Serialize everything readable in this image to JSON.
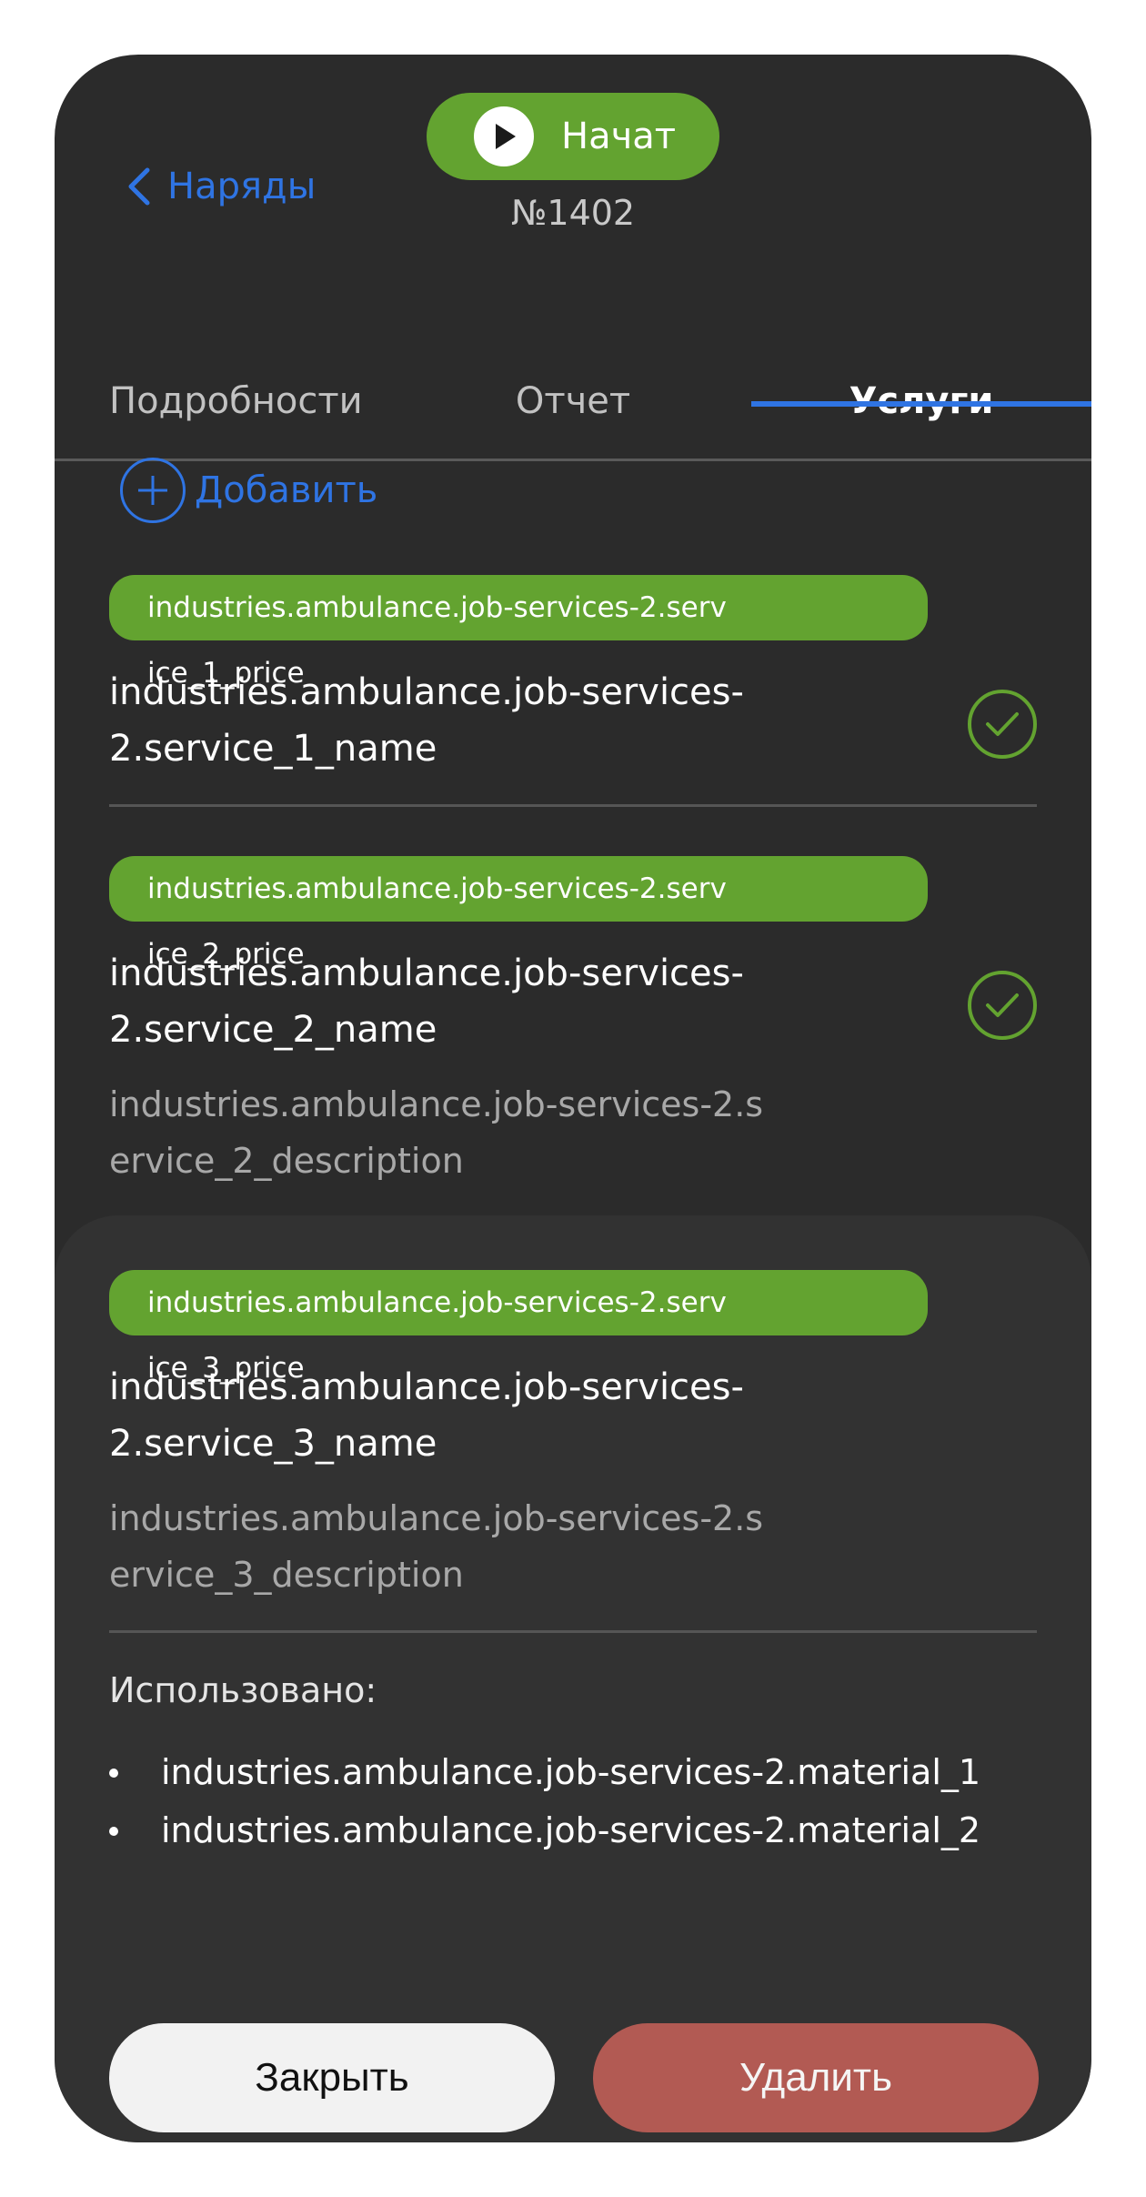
{
  "header": {
    "back_label": "Наряды",
    "start_label": "Начат",
    "order_number": "№1402"
  },
  "tabs": [
    {
      "label": "Подробности",
      "active": false
    },
    {
      "label": "Отчет",
      "active": false
    },
    {
      "label": "Услуги",
      "active": true
    }
  ],
  "add_label": "Добавить",
  "services": [
    {
      "price": "industries.ambulance.job-services-2.service_1_price",
      "name": "industries.ambulance.job-services-2.service_1_name",
      "description": "",
      "checked": true
    },
    {
      "price": "industries.ambulance.job-services-2.service_2_price",
      "name": "industries.ambulance.job-services-2.service_2_name",
      "description": "industries.ambulance.job-services-2.service_2_description",
      "checked": true
    },
    {
      "price": "industries.ambulance.job-services-2.service_3_price",
      "name": "industries.ambulance.job-services-2.service_3_name",
      "description": "industries.ambulance.job-services-2.service_3_description",
      "checked": false
    }
  ],
  "used": {
    "title": "Использовано:",
    "materials": [
      "industries.ambulance.job-services-2.material_1",
      "industries.ambulance.job-services-2.material_2"
    ]
  },
  "actions": {
    "close_label": "Закрыть",
    "delete_label": "Удалить"
  },
  "colors": {
    "accent_blue": "#2f74e3",
    "green": "#63a330",
    "delete_red": "#b25a53",
    "background": "#2b2b2b",
    "sheet": "#323232"
  }
}
